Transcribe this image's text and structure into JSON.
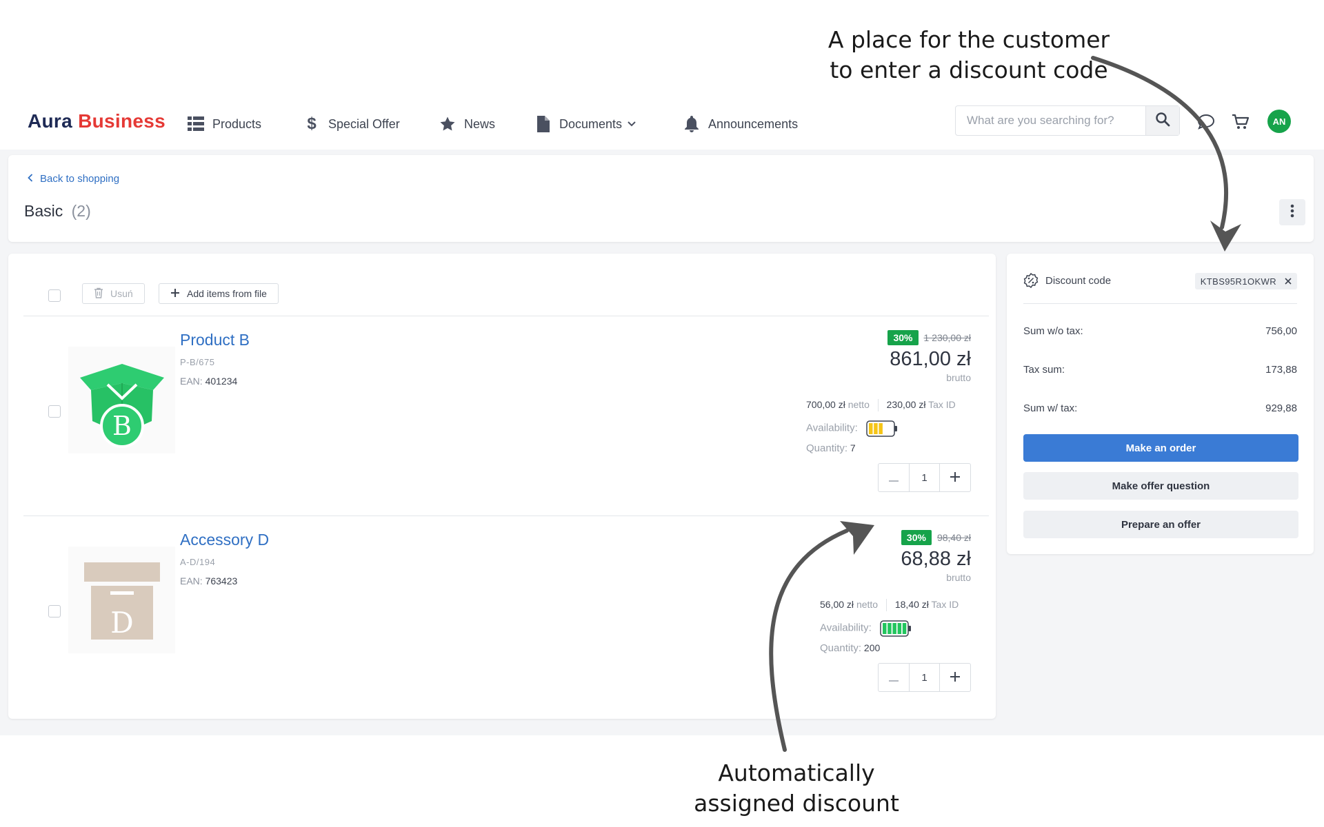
{
  "annotations": {
    "top_line1": "A place for the customer",
    "top_line2": "to enter a discount code",
    "bottom_line1": "Automatically",
    "bottom_line2": "assigned discount"
  },
  "navbar": {
    "logo_part1": "Aura",
    "logo_part2": "Business",
    "items": [
      {
        "label": "Products",
        "icon": "list-icon"
      },
      {
        "label": "Special Offer",
        "icon": "dollar-icon"
      },
      {
        "label": "News",
        "icon": "star-icon"
      },
      {
        "label": "Documents",
        "icon": "document-icon"
      },
      {
        "label": "Announcements",
        "icon": "bell-icon"
      }
    ],
    "search_placeholder": "What are you searching for?",
    "avatar_initials": "AN"
  },
  "header": {
    "back_label": "Back to shopping",
    "title": "Basic",
    "count": "(2)"
  },
  "toolbar": {
    "delete_label": "Usuń",
    "add_from_file_label": "Add items from file"
  },
  "items": [
    {
      "name": "Product B",
      "sku": "P-B/675",
      "ean_label": "EAN:",
      "ean": "401234",
      "discount_badge": "30%",
      "old_price": "1 230,00 zł",
      "price": "861,00 zł",
      "price_type": "brutto",
      "netto_value": "700,00 zł",
      "netto_label": "netto",
      "tax_value": "230,00 zł",
      "tax_label": "Tax ID",
      "availability_label": "Availability:",
      "availability_level": 0.5,
      "availability_color": "#f5c518",
      "quantity_label": "Quantity:",
      "quantity_available": "7",
      "qty": "1",
      "image_letter": "B"
    },
    {
      "name": "Accessory D",
      "sku": "A-D/194",
      "ean_label": "EAN:",
      "ean": "763423",
      "discount_badge": "30%",
      "old_price": "98,40 zł",
      "price": "68,88 zł",
      "price_type": "brutto",
      "netto_value": "56,00 zł",
      "netto_label": "netto",
      "tax_value": "18,40 zł",
      "tax_label": "Tax ID",
      "availability_label": "Availability:",
      "availability_level": 1.0,
      "availability_color": "#22c55e",
      "quantity_label": "Quantity:",
      "quantity_available": "200",
      "qty": "1",
      "image_letter": "D"
    }
  ],
  "summary": {
    "discount_label": "Discount code",
    "discount_code": "KTBS95R1OKWR",
    "rows": [
      {
        "label": "Sum w/o tax:",
        "value": "756,00"
      },
      {
        "label": "Tax sum:",
        "value": "173,88"
      },
      {
        "label": "Sum w/ tax:",
        "value": "929,88"
      }
    ],
    "make_order": "Make an order",
    "offer_question": "Make offer question",
    "prepare_offer": "Prepare an offer"
  },
  "colors": {
    "brand_dark": "#1e2a55",
    "brand_red": "#e53935",
    "link_blue": "#2f6fc3",
    "primary_button": "#3a7bd5",
    "discount_green": "#16a34a"
  }
}
